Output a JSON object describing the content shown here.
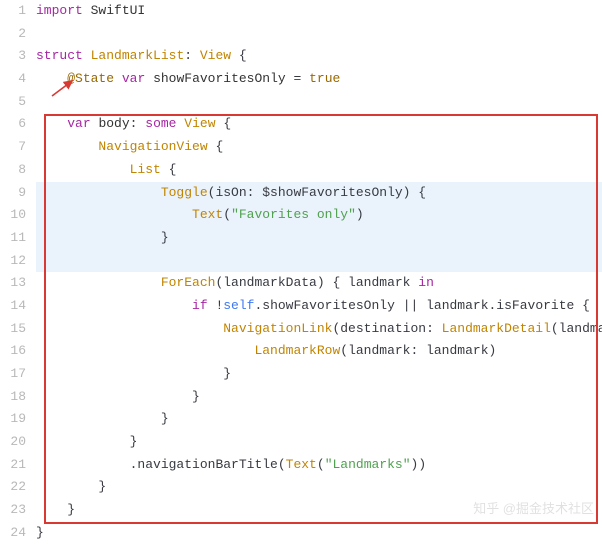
{
  "watermark": "知乎 @掘金技术社区",
  "annotations": {
    "red_box": {
      "lines_start": 6,
      "lines_end": 23
    },
    "arrow_target": "@State"
  },
  "lines": [
    {
      "n": 1,
      "hl": false,
      "indent": 0,
      "tokens": [
        {
          "cls": "kw-import",
          "t": "import"
        },
        {
          "cls": "",
          "t": " "
        },
        {
          "cls": "ident",
          "t": "SwiftUI"
        }
      ]
    },
    {
      "n": 2,
      "hl": false,
      "indent": 0,
      "tokens": []
    },
    {
      "n": 3,
      "hl": false,
      "indent": 0,
      "tokens": [
        {
          "cls": "kw-struct",
          "t": "struct"
        },
        {
          "cls": "",
          "t": " "
        },
        {
          "cls": "type",
          "t": "LandmarkList"
        },
        {
          "cls": "punct",
          "t": ": "
        },
        {
          "cls": "type",
          "t": "View"
        },
        {
          "cls": "punct",
          "t": " {"
        }
      ]
    },
    {
      "n": 4,
      "hl": false,
      "indent": 1,
      "tokens": [
        {
          "cls": "attr",
          "t": "@State"
        },
        {
          "cls": "",
          "t": " "
        },
        {
          "cls": "kw-var",
          "t": "var"
        },
        {
          "cls": "",
          "t": " "
        },
        {
          "cls": "ident",
          "t": "showFavoritesOnly"
        },
        {
          "cls": "op",
          "t": " = "
        },
        {
          "cls": "bool",
          "t": "true"
        }
      ]
    },
    {
      "n": 5,
      "hl": false,
      "indent": 0,
      "tokens": []
    },
    {
      "n": 6,
      "hl": false,
      "indent": 1,
      "tokens": [
        {
          "cls": "kw-var",
          "t": "var"
        },
        {
          "cls": "",
          "t": " "
        },
        {
          "cls": "ident",
          "t": "body"
        },
        {
          "cls": "punct",
          "t": ": "
        },
        {
          "cls": "kw-some",
          "t": "some"
        },
        {
          "cls": "",
          "t": " "
        },
        {
          "cls": "type",
          "t": "View"
        },
        {
          "cls": "punct",
          "t": " {"
        }
      ]
    },
    {
      "n": 7,
      "hl": false,
      "indent": 2,
      "tokens": [
        {
          "cls": "type",
          "t": "NavigationView"
        },
        {
          "cls": "punct",
          "t": " {"
        }
      ]
    },
    {
      "n": 8,
      "hl": false,
      "indent": 3,
      "tokens": [
        {
          "cls": "type",
          "t": "List"
        },
        {
          "cls": "punct",
          "t": " {"
        }
      ]
    },
    {
      "n": 9,
      "hl": true,
      "indent": 4,
      "tokens": [
        {
          "cls": "type",
          "t": "Toggle"
        },
        {
          "cls": "punct",
          "t": "(isOn: $showFavoritesOnly) {"
        }
      ]
    },
    {
      "n": 10,
      "hl": true,
      "indent": 5,
      "tokens": [
        {
          "cls": "type",
          "t": "Text"
        },
        {
          "cls": "punct",
          "t": "("
        },
        {
          "cls": "str",
          "t": "\"Favorites only\""
        },
        {
          "cls": "punct",
          "t": ")"
        }
      ]
    },
    {
      "n": 11,
      "hl": true,
      "indent": 4,
      "tokens": [
        {
          "cls": "punct",
          "t": "}"
        }
      ]
    },
    {
      "n": 12,
      "hl": true,
      "indent": 0,
      "tokens": []
    },
    {
      "n": 13,
      "hl": false,
      "indent": 4,
      "tokens": [
        {
          "cls": "type",
          "t": "ForEach"
        },
        {
          "cls": "punct",
          "t": "(landmarkData) { landmark "
        },
        {
          "cls": "kw-in",
          "t": "in"
        }
      ]
    },
    {
      "n": 14,
      "hl": false,
      "indent": 5,
      "tokens": [
        {
          "cls": "kw-if",
          "t": "if"
        },
        {
          "cls": "",
          "t": " !"
        },
        {
          "cls": "kw-self",
          "t": "self"
        },
        {
          "cls": "punct",
          "t": ".showFavoritesOnly || landmark.isFavorite {"
        }
      ]
    },
    {
      "n": 15,
      "hl": false,
      "indent": 6,
      "tokens": [
        {
          "cls": "type",
          "t": "NavigationLink"
        },
        {
          "cls": "punct",
          "t": "(destination: "
        },
        {
          "cls": "type",
          "t": "LandmarkDetail"
        },
        {
          "cls": "punct",
          "t": "(landmark"
        }
      ]
    },
    {
      "n": 16,
      "hl": false,
      "indent": 7,
      "tokens": [
        {
          "cls": "type",
          "t": "LandmarkRow"
        },
        {
          "cls": "punct",
          "t": "(landmark: landmark)"
        }
      ]
    },
    {
      "n": 17,
      "hl": false,
      "indent": 6,
      "tokens": [
        {
          "cls": "punct",
          "t": "}"
        }
      ]
    },
    {
      "n": 18,
      "hl": false,
      "indent": 5,
      "tokens": [
        {
          "cls": "punct",
          "t": "}"
        }
      ]
    },
    {
      "n": 19,
      "hl": false,
      "indent": 4,
      "tokens": [
        {
          "cls": "punct",
          "t": "}"
        }
      ]
    },
    {
      "n": 20,
      "hl": false,
      "indent": 3,
      "tokens": [
        {
          "cls": "punct",
          "t": "}"
        }
      ]
    },
    {
      "n": 21,
      "hl": false,
      "indent": 3,
      "tokens": [
        {
          "cls": "punct",
          "t": ".navigationBarTitle("
        },
        {
          "cls": "type",
          "t": "Text"
        },
        {
          "cls": "punct",
          "t": "("
        },
        {
          "cls": "str",
          "t": "\"Landmarks\""
        },
        {
          "cls": "punct",
          "t": "))"
        }
      ]
    },
    {
      "n": 22,
      "hl": false,
      "indent": 2,
      "tokens": [
        {
          "cls": "punct",
          "t": "}"
        }
      ]
    },
    {
      "n": 23,
      "hl": false,
      "indent": 1,
      "tokens": [
        {
          "cls": "punct",
          "t": "}"
        }
      ]
    },
    {
      "n": 24,
      "hl": false,
      "indent": 0,
      "tokens": [
        {
          "cls": "punct",
          "t": "}"
        }
      ]
    }
  ]
}
